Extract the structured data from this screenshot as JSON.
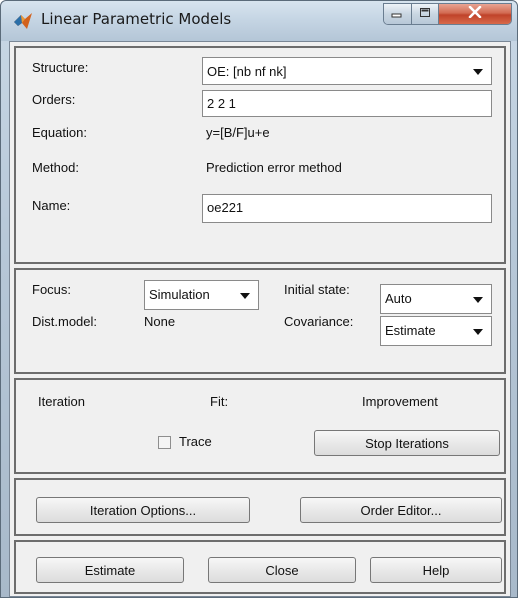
{
  "window": {
    "title": "Linear Parametric Models"
  },
  "model": {
    "structure_label": "Structure:",
    "structure_value": "OE: [nb nf nk]",
    "orders_label": "Orders:",
    "orders_value": "2 2 1",
    "equation_label": "Equation:",
    "equation_value": "y=[B/F]u+e",
    "method_label": "Method:",
    "method_value": "Prediction error method",
    "name_label": "Name:",
    "name_value": "oe221"
  },
  "options": {
    "focus_label": "Focus:",
    "focus_value": "Simulation",
    "initial_state_label": "Initial state:",
    "initial_state_value": "Auto",
    "dist_model_label": "Dist.model:",
    "dist_model_value": "None",
    "covariance_label": "Covariance:",
    "covariance_value": "Estimate"
  },
  "iteration": {
    "iteration_label": "Iteration",
    "fit_label": "Fit:",
    "improvement_label": "Improvement",
    "trace_label": "Trace",
    "trace_checked": false,
    "stop_label": "Stop Iterations"
  },
  "tools": {
    "iteration_options_label": "Iteration Options...",
    "order_editor_label": "Order Editor..."
  },
  "actions": {
    "estimate_label": "Estimate",
    "close_label": "Close",
    "help_label": "Help"
  },
  "colors": {
    "close_button": "#c0432a",
    "panel_background": "#f0f0f0"
  }
}
